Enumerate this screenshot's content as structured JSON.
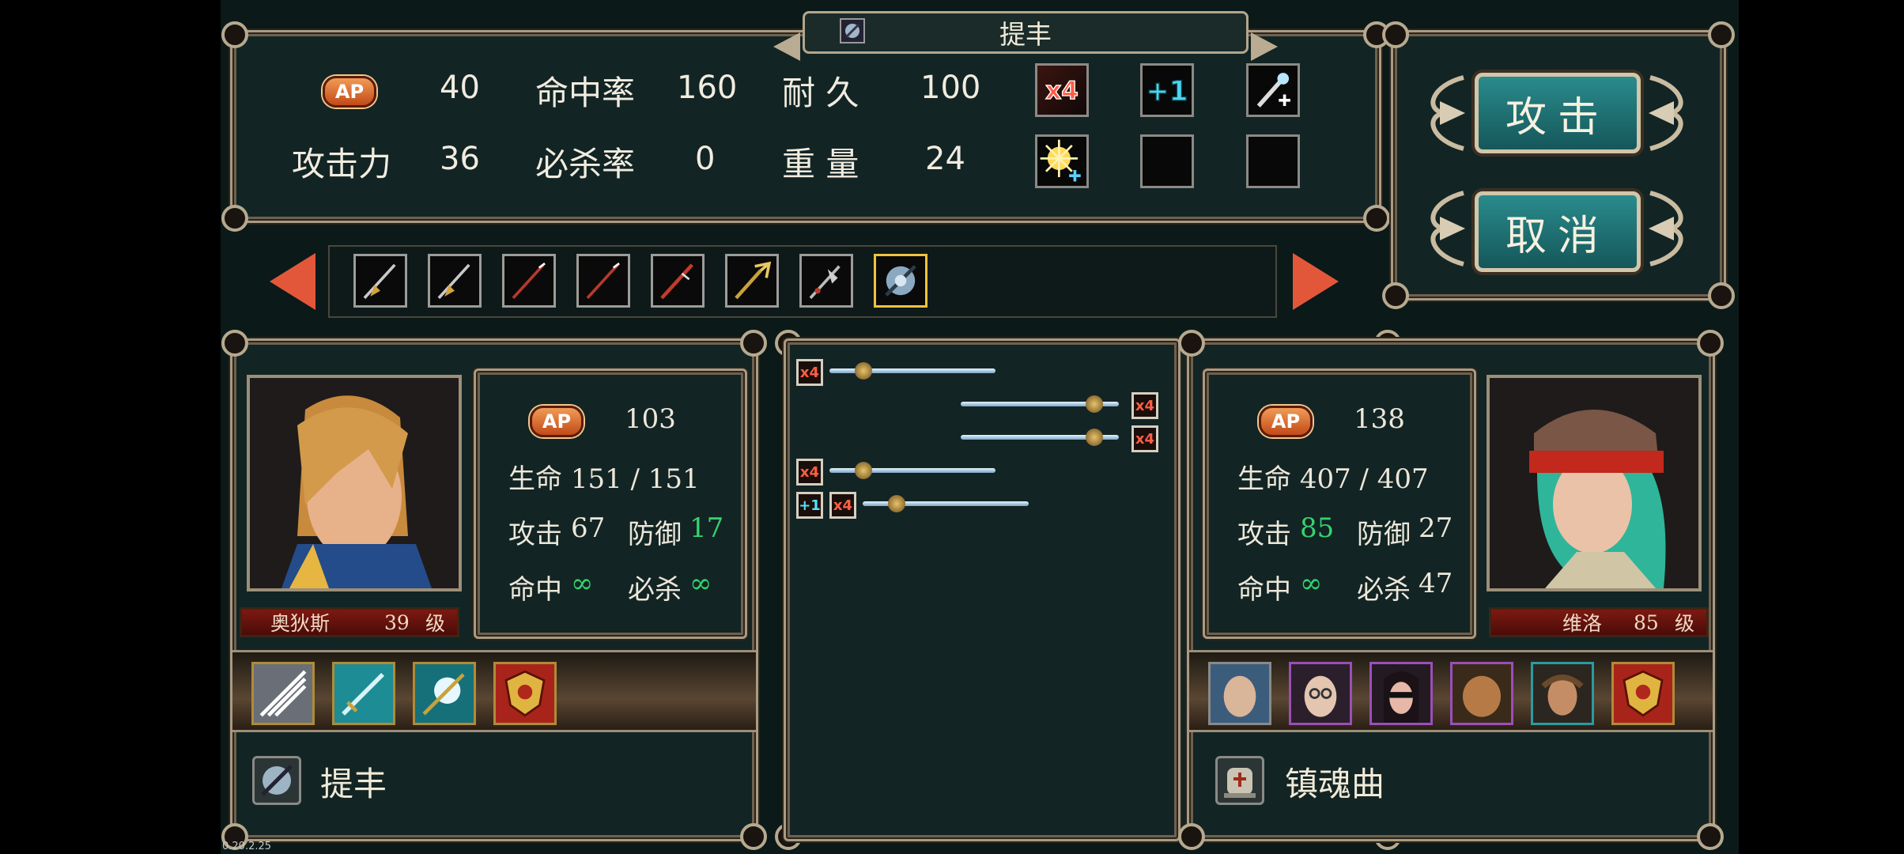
{
  "version": "0.20.2.25",
  "weapon": {
    "name": "提丰"
  },
  "stats": {
    "ap_label": "AP",
    "ap": "40",
    "hit_label": "命中率",
    "hit": "160",
    "durability_label": "耐 久",
    "durability": "100",
    "attack_label": "攻击力",
    "attack": "36",
    "crit_label": "必杀率",
    "crit": "0",
    "weight_label": "重 量",
    "weight": "24"
  },
  "effect_slots": [
    "x4",
    "+1",
    "magic-wand-plus",
    "burst-plus",
    "empty",
    "empty"
  ],
  "buttons": {
    "attack": "攻击",
    "cancel": "取消"
  },
  "weapon_list": [
    {
      "icon": "spear"
    },
    {
      "icon": "spear"
    },
    {
      "icon": "red-lance"
    },
    {
      "icon": "red-lance"
    },
    {
      "icon": "red-lance"
    },
    {
      "icon": "trident"
    },
    {
      "icon": "halberd"
    },
    {
      "icon": "typhon-blade",
      "selected": true
    }
  ],
  "player": {
    "name": "奥狄斯",
    "level": "39",
    "level_unit": "级",
    "ap_label": "AP",
    "ap": "103",
    "hp_label": "生命",
    "hp": "151 / 151",
    "atk_label": "攻击",
    "atk": "67",
    "def_label": "防御",
    "def": "17",
    "hit_label": "命中",
    "hit": "∞",
    "crit_label": "必杀",
    "crit": "∞",
    "skills": [
      "white-slash-plus",
      "teal-sword-plus",
      "star-sword-plus",
      "red-shield-plus"
    ],
    "equipped_weapon": "提丰"
  },
  "enemy": {
    "name": "维洛",
    "level": "85",
    "level_unit": "级",
    "ap_label": "AP",
    "ap": "138",
    "hp_label": "生命",
    "hp": "407 / 407",
    "atk_label": "攻击",
    "atk": "85",
    "def_label": "防御",
    "def": "27",
    "hit_label": "命中",
    "hit": "∞",
    "crit_label": "必杀",
    "crit": "47",
    "skills": [
      "bald-face",
      "glasses-face",
      "masked-woman",
      "brute-face",
      "warrior-face",
      "red-shield"
    ],
    "equipped_weapon": "镇魂曲"
  },
  "battle_preview": [
    {
      "side": "left",
      "tags": [
        "x4"
      ]
    },
    {
      "side": "right",
      "tags": [
        "x4"
      ]
    },
    {
      "side": "right",
      "tags": [
        "x4"
      ]
    },
    {
      "side": "left",
      "tags": [
        "x4"
      ]
    },
    {
      "side": "left",
      "tags": [
        "+1",
        "x4"
      ]
    }
  ],
  "colors": {
    "accent_teal": "#1f7477",
    "arrow_red": "#e2573a",
    "highlight_green": "#35d36d",
    "ap_orange": "#e0702c"
  }
}
